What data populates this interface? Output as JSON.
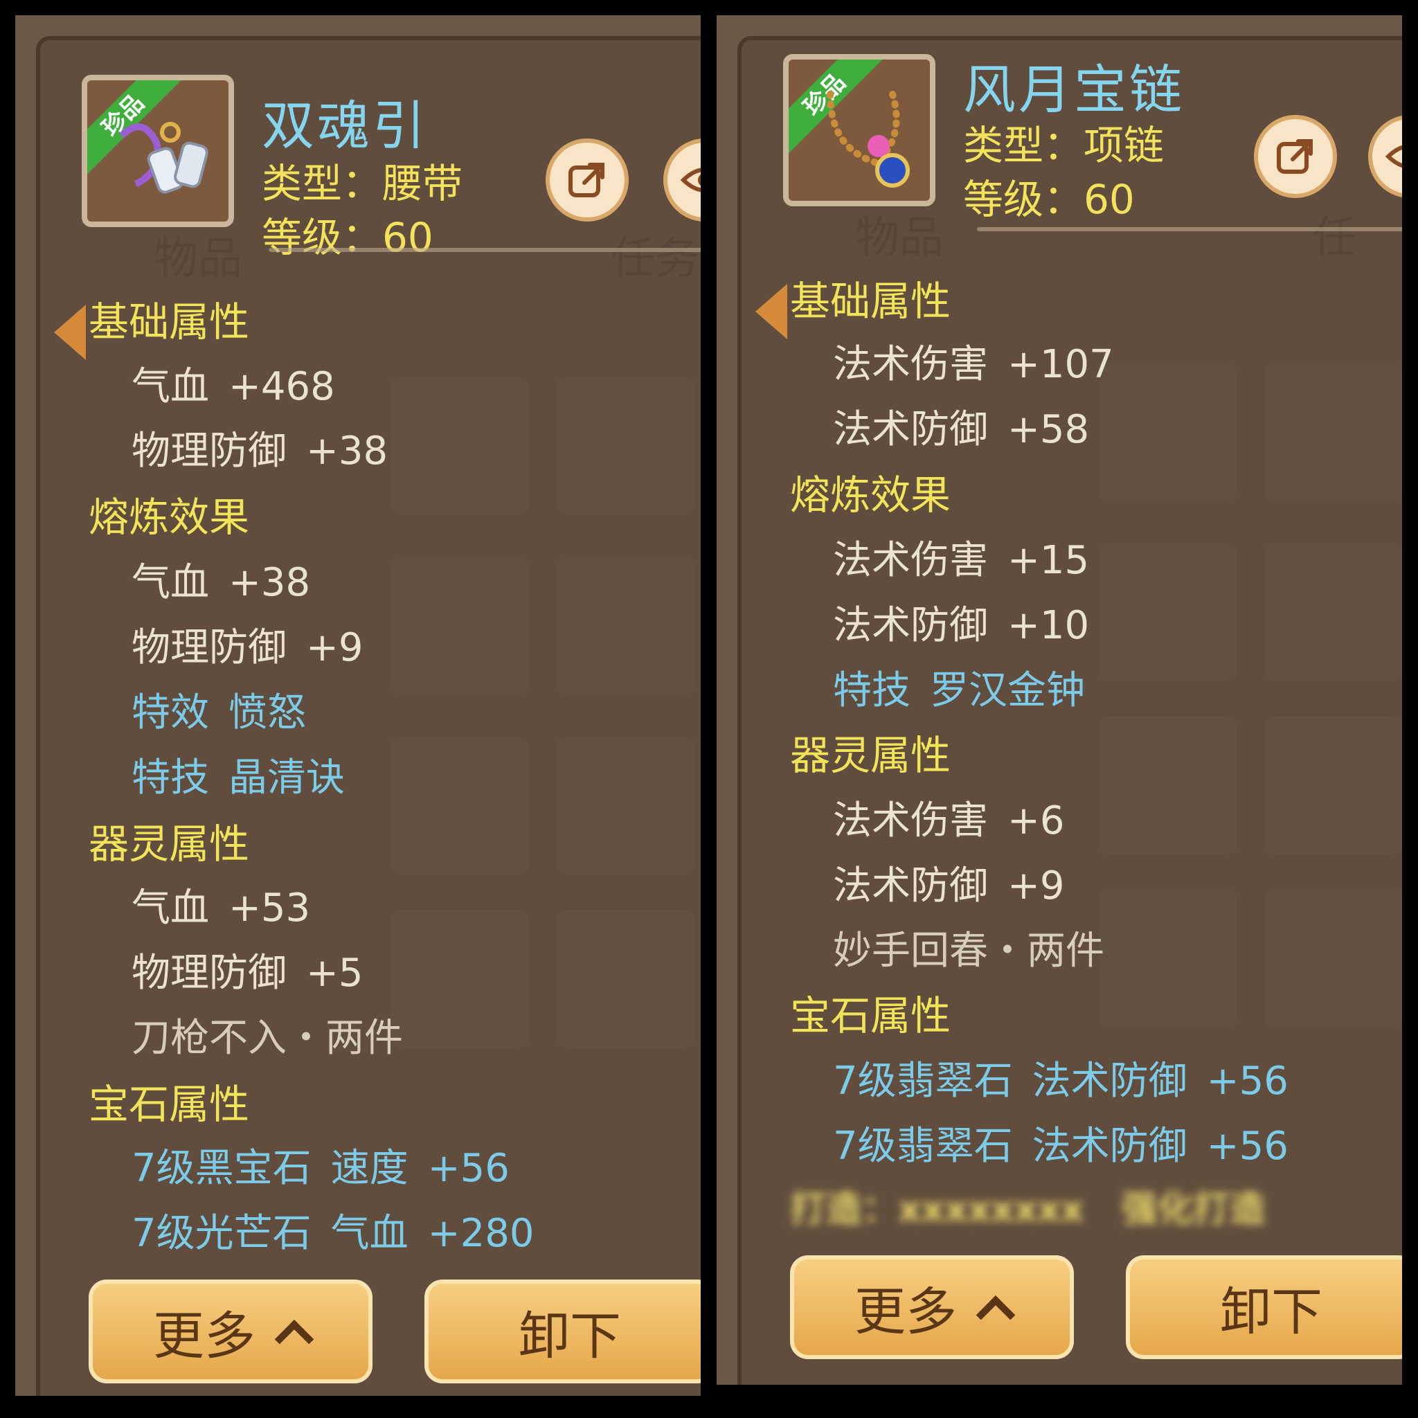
{
  "left": {
    "badge": "珍品",
    "name": "双魂引",
    "type_label": "类型：",
    "type_value": "腰带",
    "level_label": "等级：",
    "level_value": "60",
    "bg_tabs": [
      "物品",
      "任务"
    ],
    "sections": {
      "base": {
        "title": "基础属性",
        "rows": [
          {
            "name": "气血",
            "value": "+468"
          },
          {
            "name": "物理防御",
            "value": "+38"
          }
        ]
      },
      "refine": {
        "title": "熔炼效果",
        "rows": [
          {
            "name": "气血",
            "value": "+38"
          },
          {
            "name": "物理防御",
            "value": "+9"
          }
        ],
        "specials": [
          {
            "name": "特效",
            "value": "愤怒"
          },
          {
            "name": "特技",
            "value": "晶清诀"
          }
        ]
      },
      "spirit": {
        "title": "器灵属性",
        "rows": [
          {
            "name": "气血",
            "value": "+53"
          },
          {
            "name": "物理防御",
            "value": "+5"
          }
        ],
        "set": "刀枪不入・两件"
      },
      "gem": {
        "title": "宝石属性",
        "rows": [
          {
            "gem": "7级黑宝石",
            "name": "速度",
            "value": "+56"
          },
          {
            "gem": "7级光芒石",
            "name": "气血",
            "value": "+280"
          }
        ]
      }
    },
    "buttons": {
      "more": "更多",
      "unequip": "卸下"
    }
  },
  "right": {
    "badge": "珍品",
    "name": "风月宝链",
    "type_label": "类型：",
    "type_value": "项链",
    "level_label": "等级：",
    "level_value": "60",
    "bg_tabs": [
      "物品",
      "任"
    ],
    "sections": {
      "base": {
        "title": "基础属性",
        "rows": [
          {
            "name": "法术伤害",
            "value": "+107"
          },
          {
            "name": "法术防御",
            "value": "+58"
          }
        ]
      },
      "refine": {
        "title": "熔炼效果",
        "rows": [
          {
            "name": "法术伤害",
            "value": "+15"
          },
          {
            "name": "法术防御",
            "value": "+10"
          }
        ],
        "specials": [
          {
            "name": "特技",
            "value": "罗汉金钟"
          }
        ]
      },
      "spirit": {
        "title": "器灵属性",
        "rows": [
          {
            "name": "法术伤害",
            "value": "+6"
          },
          {
            "name": "法术防御",
            "value": "+9"
          }
        ],
        "set": "妙手回春・两件"
      },
      "gem": {
        "title": "宝石属性",
        "rows": [
          {
            "gem": "7级翡翠石",
            "name": "法术防御",
            "value": "+56"
          },
          {
            "gem": "7级翡翠石",
            "name": "法术防御",
            "value": "+56"
          }
        ]
      }
    },
    "crafted": {
      "label": "打造：",
      "crafter": "xxxxxxxx",
      "note": "强化打造"
    },
    "buttons": {
      "more": "更多",
      "unequip": "卸下"
    }
  }
}
